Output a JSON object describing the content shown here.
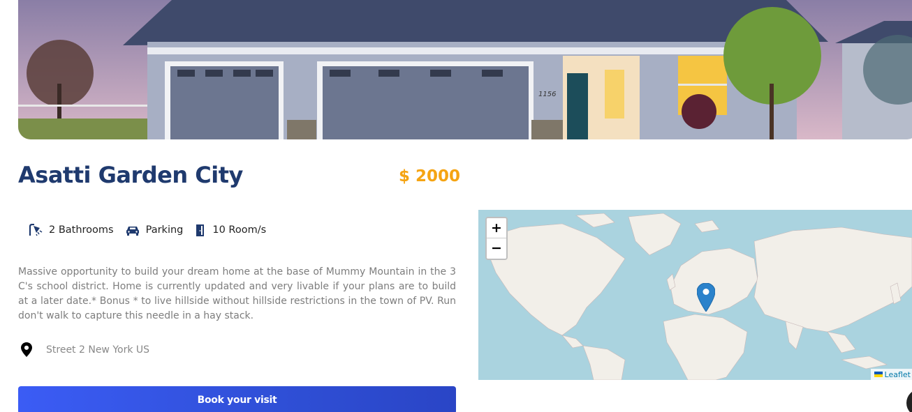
{
  "listing": {
    "title": "Asatti Garden City",
    "price": "$ 2000",
    "features": [
      {
        "icon": "shower-icon",
        "label": "2 Bathrooms"
      },
      {
        "icon": "car-icon",
        "label": "Parking"
      },
      {
        "icon": "door-icon",
        "label": "10 Room/s"
      }
    ],
    "description": "Massive opportunity to build your dream home at the base of Mummy Mountain in the 3 C's school district. Home is currently updated and very livable if your plans are to build at a later date.* Bonus * to live hillside without hillside restrictions in the town of PV. Run don't walk to capture this needle in a hay stack.",
    "address": "Street 2 New York US",
    "book_label": "Book your visit"
  },
  "map": {
    "zoom_in": "+",
    "zoom_out": "−",
    "attribution": "Leaflet",
    "marker_icon": "map-marker-icon"
  },
  "colors": {
    "title": "#1f3a6e",
    "price": "#f5a413",
    "button": "#3b5cf5",
    "water": "#aad3df",
    "land": "#f2efe9"
  },
  "house_number": "1156"
}
